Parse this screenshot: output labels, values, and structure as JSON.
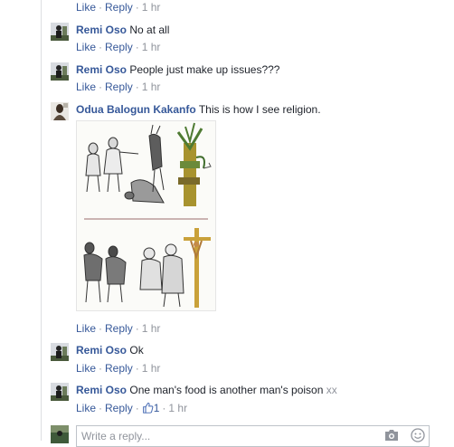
{
  "actions": {
    "like": "Like",
    "reply": "Reply",
    "separator": "·"
  },
  "top_row": {
    "time": "1 hr"
  },
  "comments": [
    {
      "author": "Remi Oso",
      "text": "No at all",
      "time": "1 hr"
    },
    {
      "author": "Remi Oso",
      "text": "People just make up issues???",
      "time": "1 hr"
    },
    {
      "author": "Odua Balogun Kakanfo",
      "text": "This is how I see religion.",
      "time": "1 hr"
    },
    {
      "author": "Remi Oso",
      "text": "Ok",
      "time": "1 hr"
    },
    {
      "author": "Remi Oso",
      "text": "One man's food is another man's poison",
      "text_suffix": "xx",
      "time": "1 hr",
      "like_count": "1"
    }
  ],
  "reply_box": {
    "placeholder": "Write a reply..."
  },
  "colors": {
    "link": "#365899",
    "muted": "#90949c",
    "text": "#1d2129",
    "border": "#dddfe2"
  },
  "icons": {
    "attachment": "cartoon-image",
    "camera": "camera-icon",
    "emoji": "smiley-icon",
    "like": "thumbs-up-icon"
  }
}
